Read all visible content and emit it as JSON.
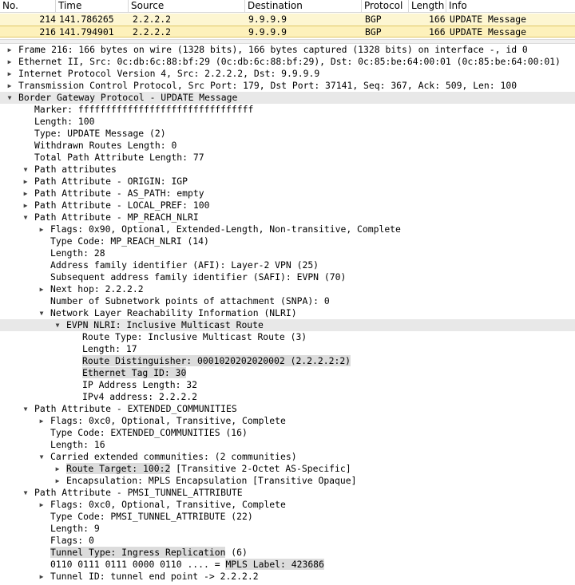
{
  "packet_list": {
    "columns": [
      "No.",
      "Time",
      "Source",
      "Destination",
      "Protocol",
      "Length",
      "Info"
    ],
    "rows": [
      {
        "no": "214",
        "time": "141.786265",
        "source": "2.2.2.2",
        "destination": "9.9.9.9",
        "protocol": "BGP",
        "length": "166",
        "info": "UPDATE Message"
      },
      {
        "no": "216",
        "time": "141.794901",
        "source": "2.2.2.2",
        "destination": "9.9.9.9",
        "protocol": "BGP",
        "length": "166",
        "info": "UPDATE Message"
      }
    ]
  },
  "details": [
    {
      "arrow": "right",
      "level": 0,
      "text": "Frame 216: 166 bytes on wire (1328 bits), 166 bytes captured (1328 bits) on interface -, id 0"
    },
    {
      "arrow": "right",
      "level": 0,
      "text": "Ethernet II, Src: 0c:db:6c:88:bf:29 (0c:db:6c:88:bf:29), Dst: 0c:85:be:64:00:01 (0c:85:be:64:00:01)"
    },
    {
      "arrow": "right",
      "level": 0,
      "text": "Internet Protocol Version 4, Src: 2.2.2.2, Dst: 9.9.9.9"
    },
    {
      "arrow": "right",
      "level": 0,
      "text": "Transmission Control Protocol, Src Port: 179, Dst Port: 37141, Seq: 367, Ack: 509, Len: 100"
    },
    {
      "arrow": "down",
      "level": 0,
      "text": "Border Gateway Protocol - UPDATE Message",
      "highlight": true
    },
    {
      "arrow": "",
      "level": 2,
      "text": "Marker: ffffffffffffffffffffffffffffffff"
    },
    {
      "arrow": "",
      "level": 2,
      "text": "Length: 100"
    },
    {
      "arrow": "",
      "level": 2,
      "text": "Type: UPDATE Message (2)"
    },
    {
      "arrow": "",
      "level": 2,
      "text": "Withdrawn Routes Length: 0"
    },
    {
      "arrow": "",
      "level": 2,
      "text": "Total Path Attribute Length: 77"
    },
    {
      "arrow": "down",
      "level": 2,
      "text": "Path attributes"
    },
    {
      "arrow": "right",
      "level": 3,
      "text": "Path Attribute - ORIGIN: IGP"
    },
    {
      "arrow": "right",
      "level": 3,
      "text": "Path Attribute - AS_PATH: empty"
    },
    {
      "arrow": "right",
      "level": 3,
      "text": "Path Attribute - LOCAL_PREF: 100"
    },
    {
      "arrow": "down",
      "level": 3,
      "text": "Path Attribute - MP_REACH_NLRI"
    },
    {
      "arrow": "right",
      "level": 4,
      "text": "Flags: 0x90, Optional, Extended-Length, Non-transitive, Complete"
    },
    {
      "arrow": "",
      "level": 4,
      "text": "Type Code: MP_REACH_NLRI (14)"
    },
    {
      "arrow": "",
      "level": 4,
      "text": "Length: 28"
    },
    {
      "arrow": "",
      "level": 4,
      "text": "Address family identifier (AFI): Layer-2 VPN (25)"
    },
    {
      "arrow": "",
      "level": 4,
      "text": "Subsequent address family identifier (SAFI): EVPN (70)"
    },
    {
      "arrow": "right",
      "level": 4,
      "text": "Next hop: 2.2.2.2"
    },
    {
      "arrow": "",
      "level": 4,
      "text": "Number of Subnetwork points of attachment (SNPA): 0"
    },
    {
      "arrow": "down",
      "level": 4,
      "text": "Network Layer Reachability Information (NLRI)"
    },
    {
      "arrow": "down",
      "level": 5,
      "text": "EVPN NLRI: Inclusive Multicast Route",
      "highlight": true
    },
    {
      "arrow": "",
      "level": 6,
      "text": "Route Type: Inclusive Multicast Route (3)"
    },
    {
      "arrow": "",
      "level": 6,
      "text": "Length: 17"
    },
    {
      "arrow": "",
      "level": 6,
      "text": "Route Distinguisher: 0001020202020002 (2.2.2.2:2)",
      "mark": "Route Distinguisher: 0001020202020002 (2.2.2.2:2)",
      "mark_rest": ""
    },
    {
      "arrow": "",
      "level": 6,
      "text": "Ethernet Tag ID: 30",
      "mark": "Ethernet Tag ID: 30",
      "mark_rest": ""
    },
    {
      "arrow": "",
      "level": 6,
      "text": "IP Address Length: 32"
    },
    {
      "arrow": "",
      "level": 6,
      "text": "IPv4 address: 2.2.2.2"
    },
    {
      "arrow": "down",
      "level": 3,
      "text": "Path Attribute - EXTENDED_COMMUNITIES"
    },
    {
      "arrow": "right",
      "level": 4,
      "text": "Flags: 0xc0, Optional, Transitive, Complete"
    },
    {
      "arrow": "",
      "level": 4,
      "text": "Type Code: EXTENDED_COMMUNITIES (16)"
    },
    {
      "arrow": "",
      "level": 4,
      "text": "Length: 16"
    },
    {
      "arrow": "down",
      "level": 4,
      "text": "Carried extended communities: (2 communities)"
    },
    {
      "arrow": "right",
      "level": 5,
      "text": "Route Target: 100:2 [Transitive 2-Octet AS-Specific]",
      "mark": "Route Target: 100:2",
      "mark_rest": " [Transitive 2-Octet AS-Specific]"
    },
    {
      "arrow": "right",
      "level": 5,
      "text": "Encapsulation: MPLS Encapsulation [Transitive Opaque]"
    },
    {
      "arrow": "down",
      "level": 3,
      "text": "Path Attribute - PMSI_TUNNEL_ATTRIBUTE"
    },
    {
      "arrow": "right",
      "level": 4,
      "text": "Flags: 0xc0, Optional, Transitive, Complete"
    },
    {
      "arrow": "",
      "level": 4,
      "text": "Type Code: PMSI_TUNNEL_ATTRIBUTE (22)"
    },
    {
      "arrow": "",
      "level": 4,
      "text": "Length: 9"
    },
    {
      "arrow": "",
      "level": 4,
      "text": "Flags: 0"
    },
    {
      "arrow": "",
      "level": 4,
      "text": "Tunnel Type: Ingress Replication (6)",
      "mark": "Tunnel Type: Ingress Replication",
      "mark_rest": " (6)"
    },
    {
      "arrow": "",
      "level": 4,
      "text": "0110 0111 0111 0000 0110 .... = MPLS Label: 423686",
      "pre": "0110 0111 0111 0000 0110 .... = ",
      "mark": "MPLS Label: 423686",
      "mark_rest": ""
    },
    {
      "arrow": "right",
      "level": 4,
      "text": "Tunnel ID: tunnel end point -> 2.2.2.2"
    }
  ]
}
